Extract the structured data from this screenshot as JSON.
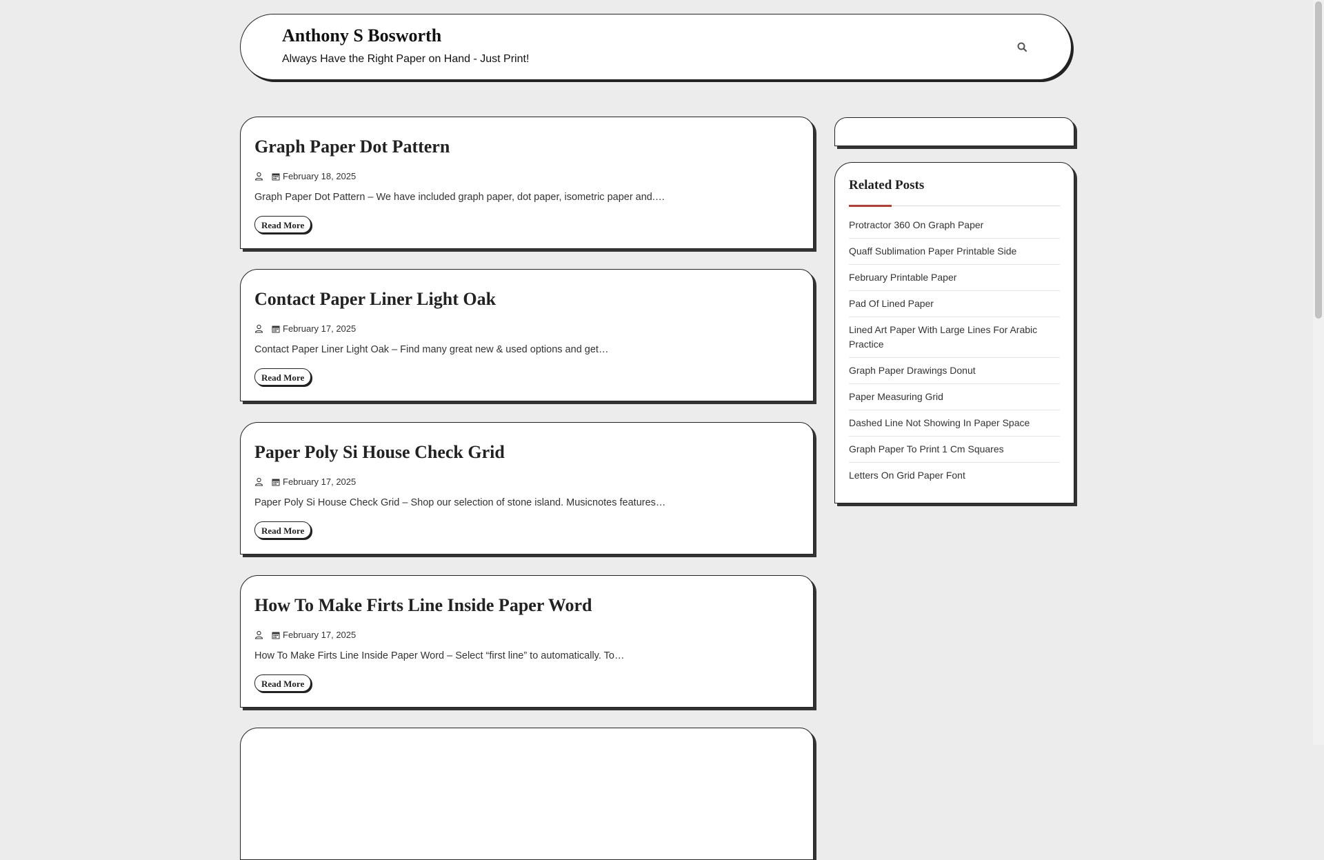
{
  "header": {
    "site_title": "Anthony S Bosworth",
    "tagline": "Always Have the Right Paper on Hand - Just Print!",
    "search_icon": "search-icon"
  },
  "posts": [
    {
      "title": "Graph Paper Dot Pattern",
      "date": "February 18, 2025",
      "excerpt": "Graph Paper Dot Pattern – We have included graph paper, dot paper, isometric paper and.…",
      "read_more": "Read More"
    },
    {
      "title": "Contact Paper Liner Light Oak",
      "date": "February 17, 2025",
      "excerpt": "Contact Paper Liner Light Oak – Find many great new & used options and get…",
      "read_more": "Read More"
    },
    {
      "title": "Paper Poly Si House Check Grid",
      "date": "February 17, 2025",
      "excerpt": "Paper Poly Si House Check Grid – Shop our selection of stone island. Musicnotes features…",
      "read_more": "Read More"
    },
    {
      "title": "How To Make Firts Line Inside Paper Word",
      "date": "February 17, 2025",
      "excerpt": "How To Make Firts Line Inside Paper Word – Select “first line” to automatically. To…",
      "read_more": "Read More"
    }
  ],
  "sidebar": {
    "related_heading": "Related Posts",
    "related": [
      "Protractor 360 On Graph Paper",
      "Quaff Sublimation Paper Printable Side",
      "February Printable Paper",
      "Pad Of Lined Paper",
      "Lined Art Paper With Large Lines For Arabic Practice",
      "Graph Paper Drawings Donut",
      "Paper Measuring Grid",
      "Dashed Line Not Showing In Paper Space",
      "Graph Paper To Print 1 Cm Squares",
      "Letters On Grid Paper Font"
    ]
  },
  "colors": {
    "background": "#ececec",
    "accent": "#c0392b",
    "border": "#222222"
  }
}
